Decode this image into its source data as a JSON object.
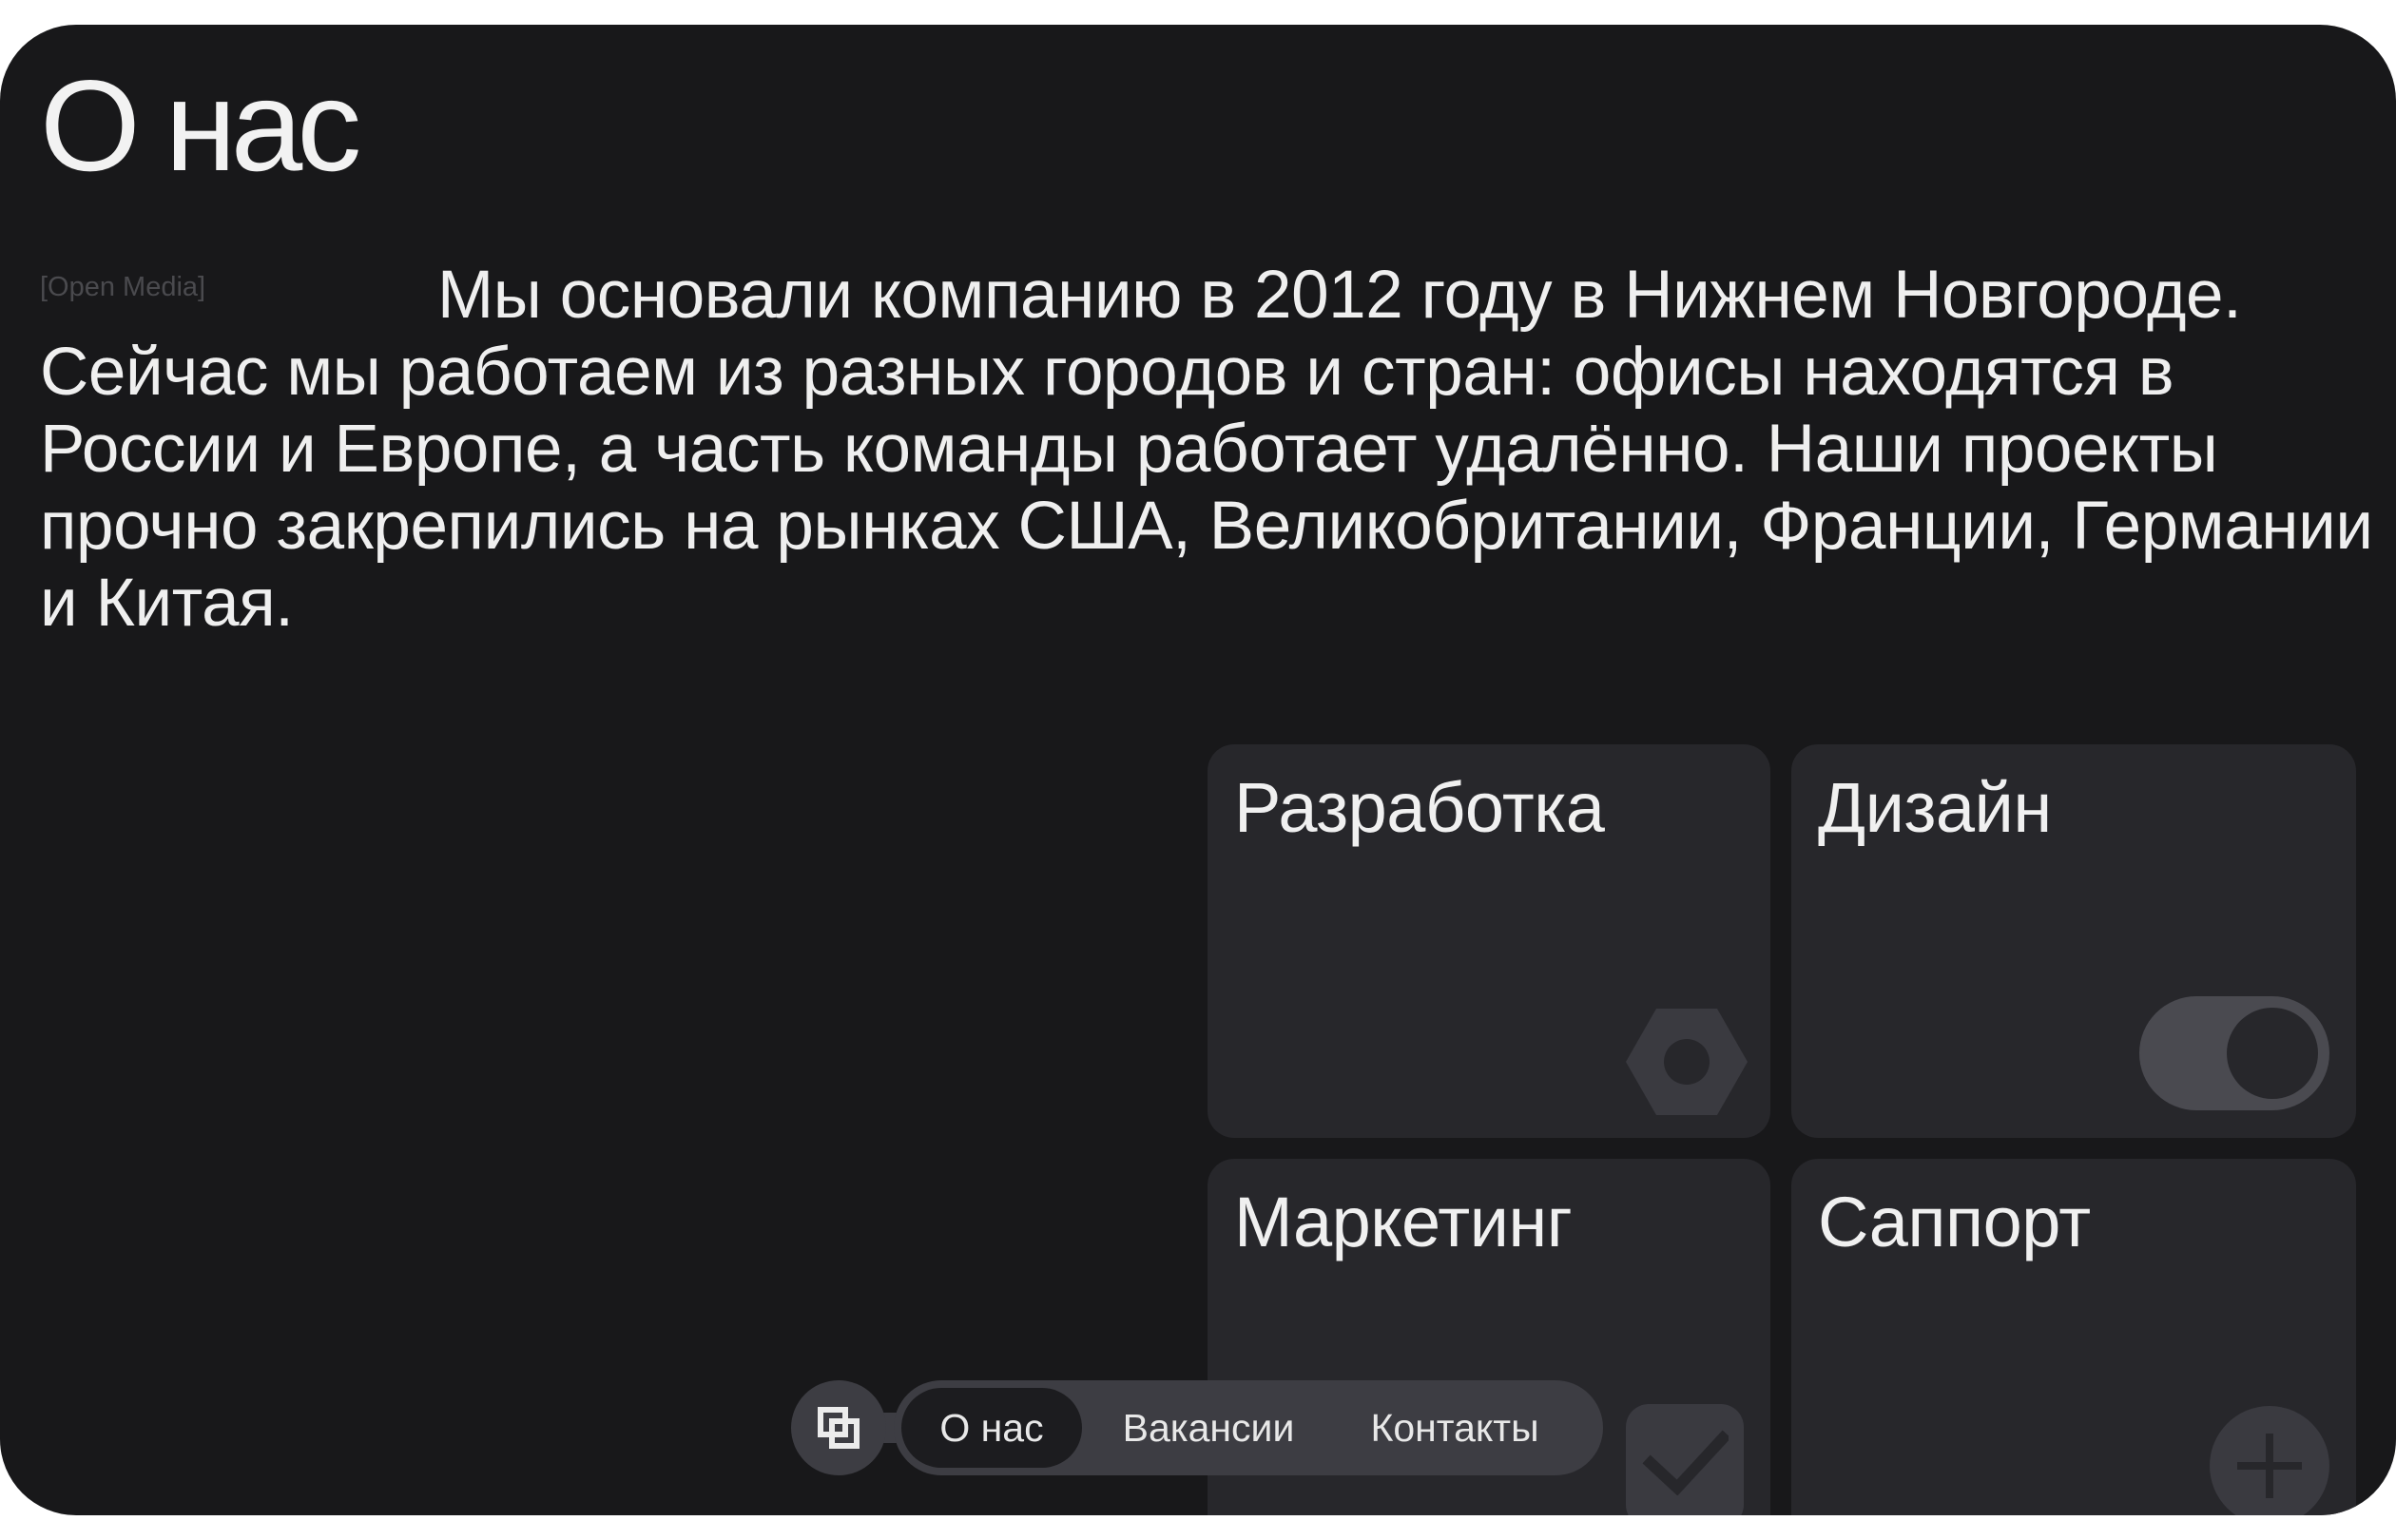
{
  "page": {
    "title": "О нас",
    "brand_tag": "[Open Media]",
    "about_text": "Мы основали компанию в 2012 году в Нижнем Новгороде. Сейчас мы работаем из разных городов и стран: офисы находятся в России и Европе, а часть команды работает удалённо. Наши проекты прочно закрепились на рынках США, Великобритании, Франции, Германии и Китая."
  },
  "cards": [
    {
      "label": "Разработка",
      "icon": "hex-nut-icon"
    },
    {
      "label": "Дизайн",
      "icon": "toggle-icon"
    },
    {
      "label": "Маркетинг",
      "icon": "checkmark-icon"
    },
    {
      "label": "Саппорт",
      "icon": "plus-icon"
    }
  ],
  "nav": {
    "home_icon": "square-logo-icon",
    "items": [
      {
        "label": "О нас",
        "active": true
      },
      {
        "label": "Вакансии",
        "active": false
      },
      {
        "label": "Контакты",
        "active": false
      }
    ]
  },
  "colors": {
    "background": "#18181a",
    "card": "#27272b",
    "nav": "#3d3d43",
    "text": "#f0f0f0",
    "muted": "#4a4a4e"
  }
}
